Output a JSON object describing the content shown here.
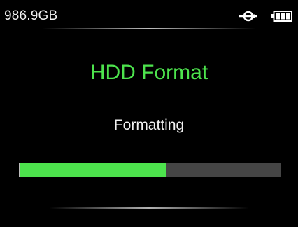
{
  "status_bar": {
    "capacity": "986.9GB",
    "usb_icon": "usb-connected-icon",
    "battery_icon": "battery-full-icon"
  },
  "dialog": {
    "title": "HDD Format",
    "status": "Formatting",
    "progress": 0.56
  },
  "colors": {
    "accent": "#4de34d",
    "background": "#000000",
    "progress_track": "#454545",
    "text": "#f2f2f2"
  }
}
